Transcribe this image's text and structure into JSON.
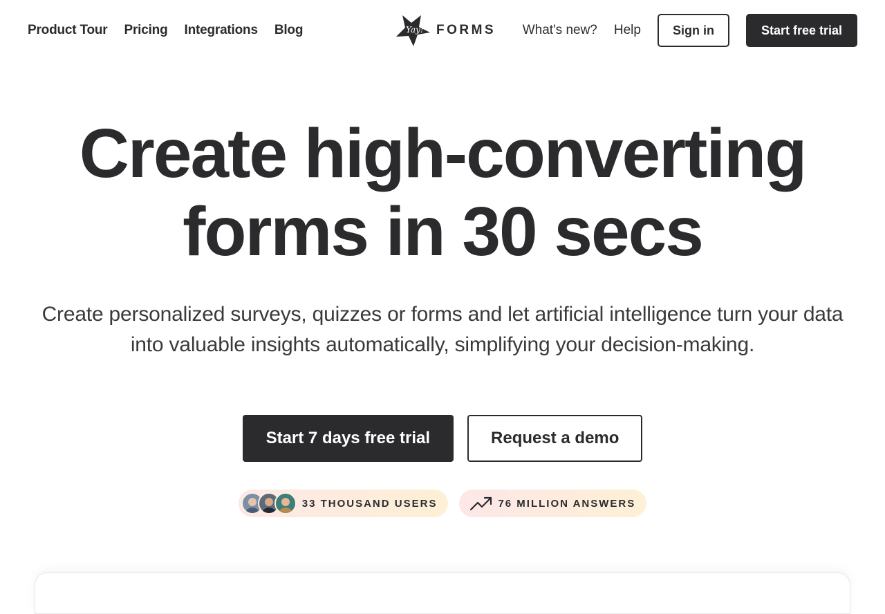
{
  "nav": {
    "left_links": [
      {
        "label": "Product Tour"
      },
      {
        "label": "Pricing"
      },
      {
        "label": "Integrations"
      },
      {
        "label": "Blog"
      }
    ],
    "logo": {
      "mark_text": "Yay!",
      "wordmark": "FORMS"
    },
    "whats_new": "What's new?",
    "help": "Help",
    "sign_in": "Sign in",
    "start_trial": "Start free trial"
  },
  "hero": {
    "title_line1": "Create high-converting",
    "title_line2": "forms in 30 secs",
    "subtitle": "Create personalized surveys, quizzes or forms and let artificial intelligence turn your data into valuable insights automatically, simplifying your decision-making.",
    "primary_cta": "Start 7 days free trial",
    "secondary_cta": "Request a demo"
  },
  "stats": {
    "users": "33 THOUSAND USERS",
    "answers": "76 MILLION ANSWERS"
  },
  "icons": {
    "trend": "trending-up-icon",
    "logo": "yay-star-icon"
  },
  "colors": {
    "ink": "#2b2b2e",
    "badge_start": "#fde7e7",
    "badge_end": "#fdf0d5"
  }
}
